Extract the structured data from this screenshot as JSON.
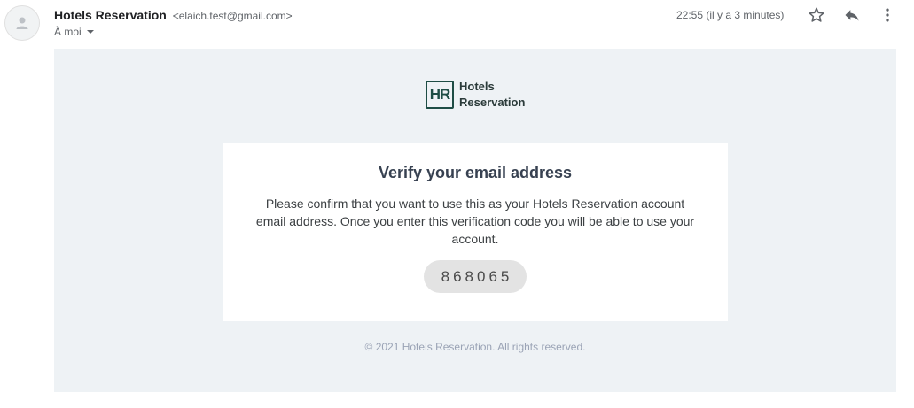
{
  "header": {
    "sender_name": "Hotels Reservation",
    "sender_email": "<elaich.test@gmail.com>",
    "recipient_label": "À moi",
    "timestamp": "22:55 (il y a 3 minutes)",
    "icons": [
      "avatar-icon",
      "star-icon",
      "reply-icon",
      "more-vert-icon"
    ]
  },
  "email": {
    "logo_monogram": "HR",
    "logo_line1": "Hotels",
    "logo_line2": "Reservation",
    "title": "Verify your email address",
    "message": "Please confirm that you want to use this as your Hotels Reservation account email address. Once you enter this verification code you will be able to use your account.",
    "code": "868065",
    "footer": "© 2021 Hotels Reservation. All rights reserved."
  },
  "colors": {
    "body_bg": "#eef2f5",
    "brand": "#1e4d45",
    "code_bg": "#e3e3e3",
    "footer_text": "#9aa3b5"
  }
}
